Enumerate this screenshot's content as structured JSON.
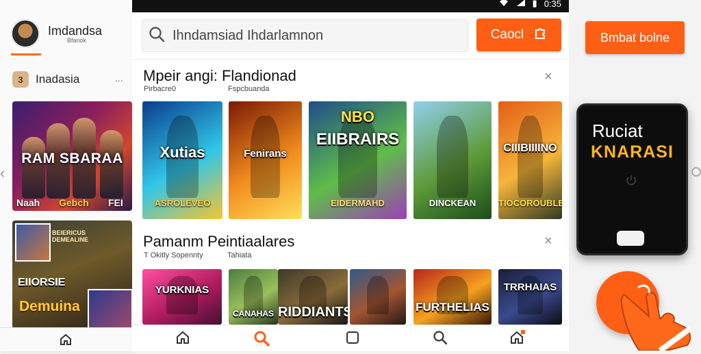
{
  "status": {
    "left_icons": [
      "grid-icon",
      "box-icon",
      "box-icon"
    ],
    "time": "0:35"
  },
  "sidebar": {
    "profile_name": "Imdandsa",
    "profile_sub": "Bfanok",
    "section_badge": "3",
    "section_label": "Inadasia",
    "more": "...",
    "banner1": {
      "title": "RAM SBARAA",
      "cap1": "Naah",
      "cap2": "Gebch",
      "cap3": "FEI"
    },
    "banner2": {
      "head": "BEIERICUS\nDEMEALINE",
      "mid": "EIIORSIE",
      "bot": "Demuina"
    }
  },
  "search": {
    "placeholder": "Ihndamsiad Ihdarlamnon",
    "icon": "search-icon"
  },
  "cancel_button": {
    "label": "Caocl",
    "icon": "puzzle-icon"
  },
  "section1": {
    "title": "Mpeir angi: Flandionad",
    "sub_left": "Pirbacre0",
    "sub_right": "Fspcbuanda",
    "close": "×",
    "tiles": [
      {
        "title": "Xutias",
        "bottom": "ASROLEVEO",
        "colors": [
          "#0b3c8c",
          "#31c6e8",
          "#f5c531"
        ],
        "bot_color": "#ffd54a"
      },
      {
        "title": "Fenirans",
        "bottom": "",
        "colors": [
          "#7a1a06",
          "#f28b1e",
          "#ffdf5a"
        ],
        "bot_color": "#ffffff"
      },
      {
        "title": "EIIBRAIRS",
        "bottom": "EIDERMAHD",
        "top": "NBO",
        "colors": [
          "#1f4d8a",
          "#5fbd49",
          "#9d3fb6"
        ],
        "bot_color": "#ffe07a"
      },
      {
        "title": "",
        "bottom": "DINCKEAN",
        "colors": [
          "#8fd0ef",
          "#5f9b3a",
          "#1b4d1a"
        ],
        "bot_color": "#ffffff"
      },
      {
        "title": "CIIIBIIIINO",
        "bottom": "TIOCOROUBLE",
        "colors": [
          "#e35f16",
          "#f6b53b",
          "#2e3a23"
        ],
        "bot_color": "#ffe04d"
      }
    ]
  },
  "section2": {
    "title": "Pamanm Peintiaalares",
    "sub_left": "T Okitly Sopennty",
    "sub_right": "Tahiata",
    "close": "×",
    "tiles": [
      {
        "title": "YURKNIAS",
        "colors": [
          "#ff4fa0",
          "#b01c5f",
          "#421034"
        ]
      },
      {
        "title": "CANAHAS",
        "colors": [
          "#4b7e3e",
          "#9bbf5d",
          "#24381f"
        ]
      },
      {
        "title": "RIDDIANTS",
        "colors": [
          "#3c3a2a",
          "#8a6b3a",
          "#181818"
        ]
      },
      {
        "title": "",
        "colors": [
          "#2f5c8a",
          "#a35532",
          "#241814"
        ]
      },
      {
        "title": "FURTHELIAS",
        "colors": [
          "#b8261a",
          "#f6a11f",
          "#341808"
        ]
      },
      {
        "title": "TRRHAIAS",
        "colors": [
          "#1b1d36",
          "#3a4a8e",
          "#0c0c14"
        ]
      }
    ]
  },
  "bottom_nav": [
    {
      "icon": "home-icon",
      "active": false
    },
    {
      "icon": "search-icon",
      "active": true
    },
    {
      "icon": "square-icon",
      "active": false
    },
    {
      "icon": "search-icon",
      "active": false
    },
    {
      "icon": "home-icon",
      "active": false
    }
  ],
  "right": {
    "button_label": "Bmbat bolne",
    "phone_line1": "Ruciat",
    "phone_line2": "KNARASI"
  },
  "colors": {
    "accent": "#ff5f14"
  }
}
